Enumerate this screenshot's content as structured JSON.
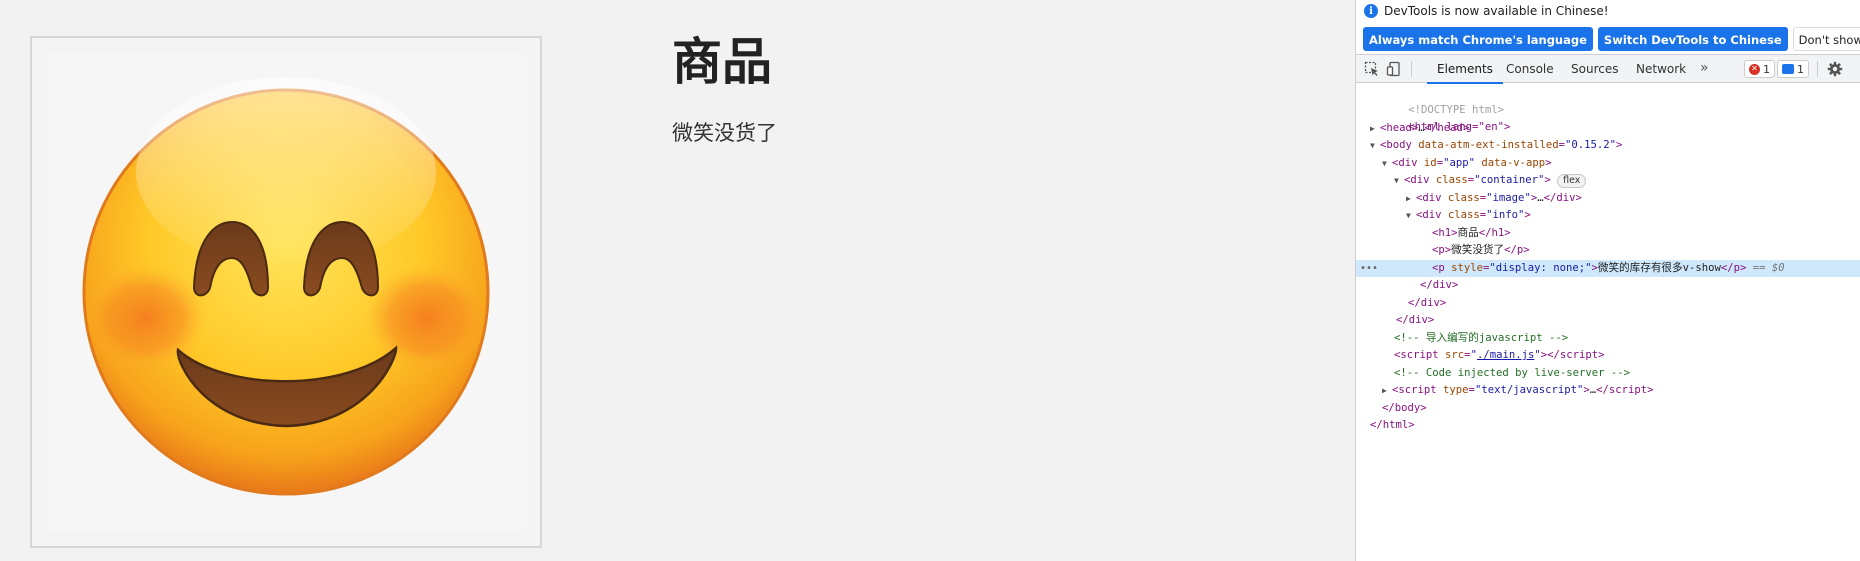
{
  "page": {
    "heading": "商品",
    "description": "微笑没货了"
  },
  "devtools": {
    "banner": {
      "message": "DevTools is now available in Chinese!",
      "btn_match": "Always match Chrome's language",
      "btn_switch": "Switch DevTools to Chinese",
      "btn_dismiss": "Don't show again"
    },
    "tabs": [
      "Elements",
      "Console",
      "Sources",
      "Network"
    ],
    "more": "»",
    "errors_count": "1",
    "messages_count": "1",
    "dom": {
      "doctype": "<!DOCTYPE html>",
      "html_open": "<html lang=\"en\">",
      "head_open": "<head>",
      "ellipsis": "…",
      "head_close": "</head>",
      "body_tag": "body",
      "body_attr": "data-atm-ext-installed",
      "body_val": "\"0.15.2\"",
      "app_tag": "div",
      "app_id_attr": "id",
      "app_id_val": "\"app\"",
      "app_attr2": "data-v-app",
      "container_class": "\"container\"",
      "flex_badge": "flex",
      "image_class": "\"image\"",
      "info_class": "\"info\"",
      "h1_text": "商品",
      "p1_text": "微笑没货了",
      "p2_style_attr": "style",
      "p2_style_val": "\"display: none;\"",
      "p2_text": "微笑的库存有很多v-show",
      "selected_marker": "== $0",
      "comment_import": "<!-- 导入编写的javascript -->",
      "script_src_val": "./main.js",
      "comment_live": "<!-- Code injected by live-server -->",
      "script_type_val": "\"text/javascript\""
    }
  }
}
